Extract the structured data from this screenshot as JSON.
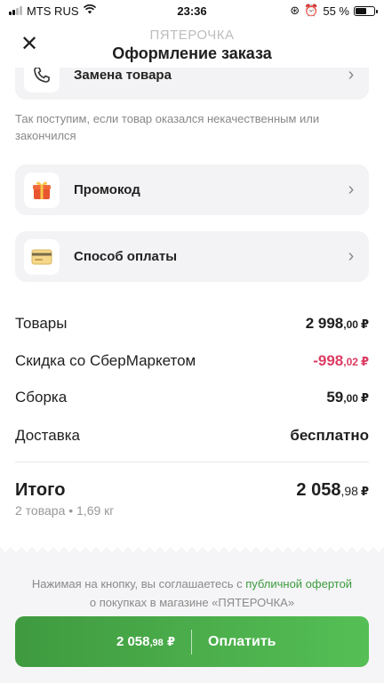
{
  "status_bar": {
    "carrier": "MTS RUS",
    "time": "23:36",
    "battery": "55 %",
    "battery_level": 0.55
  },
  "header": {
    "store": "ПЯТЕРОЧКА",
    "title": "Оформление заказа",
    "close_glyph": "✕"
  },
  "replacement": {
    "label": "Замена товара",
    "icon": "phone-icon",
    "hint": "Так поступим, если товар оказался некачественным или закончился"
  },
  "promo": {
    "label": "Промокод",
    "icon": "gift-icon"
  },
  "payment": {
    "label": "Способ оплаты",
    "icon": "credit-card-icon"
  },
  "summary": {
    "goods": {
      "label": "Товары",
      "whole": "2 998",
      "cents": ",00",
      "currency": "₽"
    },
    "discount": {
      "label": "Скидка со СберМаркетом",
      "whole": "-998",
      "cents": ",02",
      "currency": "₽",
      "color": "#dc3c63"
    },
    "assembly": {
      "label": "Сборка",
      "whole": "59",
      "cents": ",00",
      "currency": "₽"
    },
    "delivery": {
      "label": "Доставка",
      "value": "бесплатно"
    },
    "total": {
      "label": "Итого",
      "whole": "2 058",
      "cents": ",98",
      "currency": "₽",
      "sub": "2 товара • 1,69 кг"
    }
  },
  "footer": {
    "terms_prefix": "Нажимая на кнопку, вы соглашаетесь с ",
    "terms_link": "публичной офертой",
    "terms_suffix": "о покупках в магазине «ПЯТЕРОЧКА»",
    "button": {
      "price_whole": "2 058",
      "price_cents": ",98",
      "currency": "₽",
      "label": "Оплатить"
    }
  },
  "colors": {
    "accent": "#4caf50",
    "discount": "#dc3c63",
    "link": "#3c9b3e"
  }
}
